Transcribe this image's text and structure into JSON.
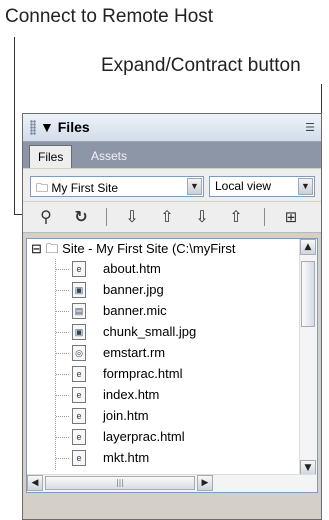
{
  "callouts": {
    "connect": "Connect to Remote Host",
    "expand": "Expand/Contract button"
  },
  "panel": {
    "title": "Files",
    "tabs": [
      "Files",
      "Assets"
    ],
    "site_select": "My First Site",
    "view_select": "Local view",
    "toolbar": [
      "connect-icon",
      "refresh-icon",
      "get-icon",
      "put-icon",
      "check-out-icon",
      "check-in-icon",
      "expand-icon"
    ]
  },
  "tree": {
    "root": "Site - My First Site (C:\\myFirst",
    "files": [
      {
        "name": "about.htm",
        "icon": "html-file-icon"
      },
      {
        "name": "banner.jpg",
        "icon": "image-file-icon"
      },
      {
        "name": "banner.mic",
        "icon": "mic-file-icon"
      },
      {
        "name": "chunk_small.jpg",
        "icon": "image-file-icon"
      },
      {
        "name": "emstart.rm",
        "icon": "media-file-icon"
      },
      {
        "name": "formprac.html",
        "icon": "html-file-icon"
      },
      {
        "name": "index.htm",
        "icon": "html-file-icon"
      },
      {
        "name": "join.htm",
        "icon": "html-file-icon"
      },
      {
        "name": "layerprac.html",
        "icon": "html-file-icon"
      },
      {
        "name": "mkt.htm",
        "icon": "html-file-icon"
      }
    ]
  }
}
